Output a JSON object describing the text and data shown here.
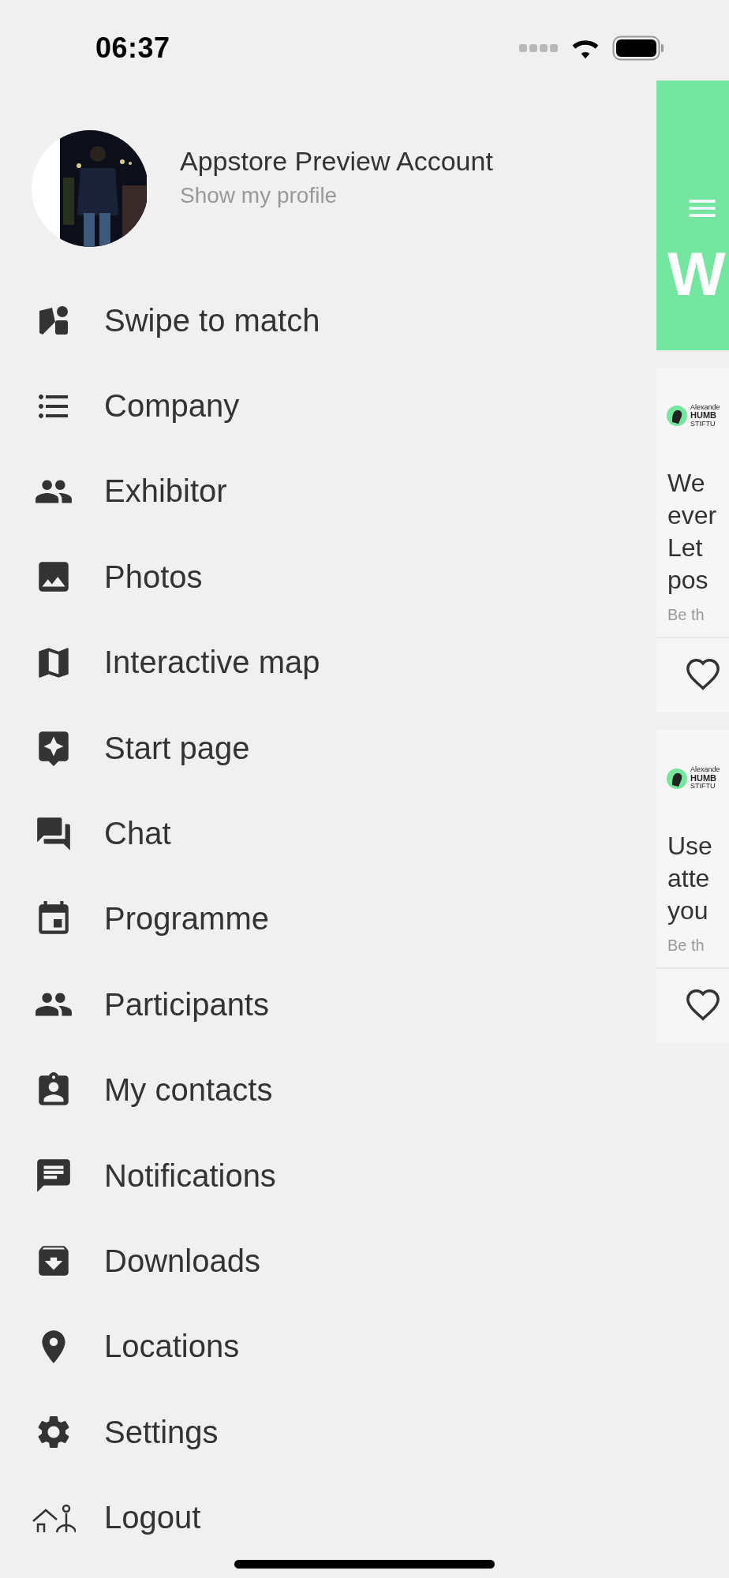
{
  "status_bar": {
    "time": "06:37"
  },
  "profile": {
    "name": "Appstore Preview Account",
    "link": "Show my profile"
  },
  "menu": [
    {
      "label": "Swipe to match"
    },
    {
      "label": "Company"
    },
    {
      "label": "Exhibitor"
    },
    {
      "label": "Photos"
    },
    {
      "label": "Interactive map"
    },
    {
      "label": "Start page"
    },
    {
      "label": "Chat"
    },
    {
      "label": "Programme"
    },
    {
      "label": "Participants"
    },
    {
      "label": "My contacts"
    },
    {
      "label": "Notifications"
    },
    {
      "label": "Downloads"
    },
    {
      "label": "Locations"
    },
    {
      "label": "Settings"
    },
    {
      "label": "Logout"
    }
  ],
  "behind": {
    "title": "W",
    "posts": [
      {
        "logo_lines": [
          "Alexande",
          "HUMB",
          "STIFTU"
        ],
        "text_lines": [
          "We",
          "ever",
          "Let",
          "pos"
        ],
        "meta": "Be th"
      },
      {
        "logo_lines": [
          "Alexande",
          "HUMB",
          "STIFTU"
        ],
        "text_lines": [
          "Use",
          "atte",
          "you"
        ],
        "meta": "Be th"
      }
    ]
  }
}
